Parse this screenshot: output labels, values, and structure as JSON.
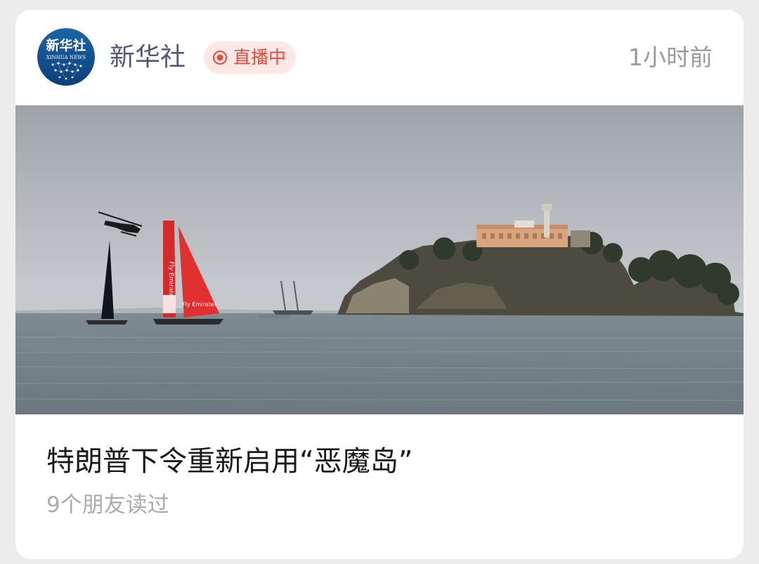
{
  "account": {
    "name": "新华社",
    "logo_text": "新华社",
    "logo_subtext": "XINHUA NEWS"
  },
  "live_badge": {
    "label": "直播中",
    "icon": "live-dot-icon",
    "color": "#e64b3b"
  },
  "time_ago": "1小时前",
  "article": {
    "headline": "特朗普下令重新启用“恶魔岛”",
    "readers": "9个朋友读过"
  },
  "sail_labels": {
    "left": "Fly Emirates",
    "right": "Fly Emirates"
  }
}
